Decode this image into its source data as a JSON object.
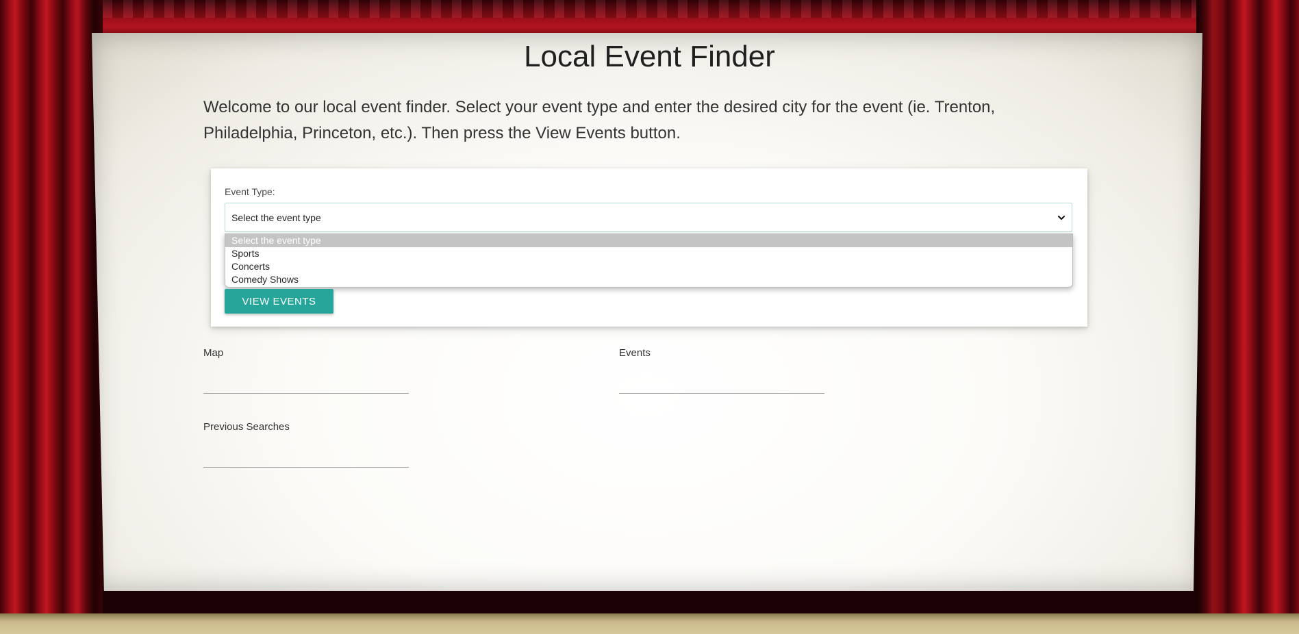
{
  "page": {
    "title": "Local Event Finder",
    "intro": "Welcome to our local event finder. Select your event type and enter the desired city for the event (ie. Trenton, Philadelphia, Princeton, etc.). Then press the View Events button."
  },
  "form": {
    "event_type_label": "Event Type:",
    "select_value": "Select the event type",
    "options": [
      "Select the event type",
      "Sports",
      "Concerts",
      "Comedy Shows"
    ],
    "selected_index": 0,
    "view_button_label": "VIEW EVENTS"
  },
  "sections": {
    "map_label": "Map",
    "events_label": "Events",
    "previous_searches_label": "Previous Searches"
  },
  "colors": {
    "accent": "#26a69a",
    "curtain": "#b3141f"
  },
  "icons": {
    "select_arrow": "chevron-down-icon"
  }
}
